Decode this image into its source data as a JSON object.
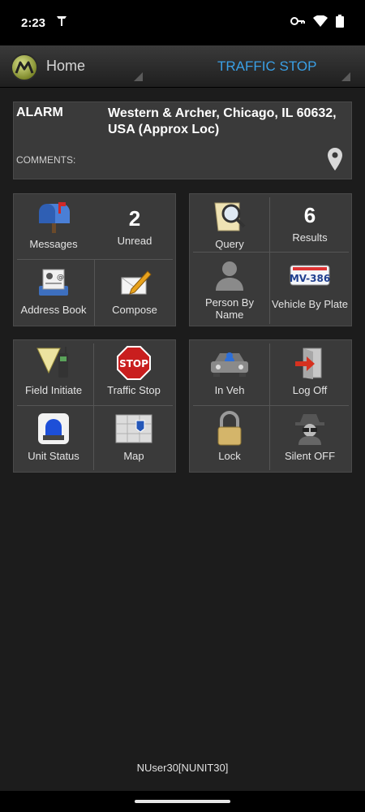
{
  "status_bar": {
    "time": "2:23"
  },
  "header": {
    "title": "Home",
    "mode": "TRAFFIC STOP"
  },
  "alarm": {
    "type": "ALARM",
    "address": "Western & Archer, Chicago, IL 60632, USA (Approx Loc)",
    "comments_label": "COMMENTS:"
  },
  "messages_panel": {
    "messages": "Messages",
    "unread_count": "2",
    "unread": "Unread",
    "address_book": "Address Book",
    "compose": "Compose"
  },
  "query_panel": {
    "query": "Query",
    "results_count": "6",
    "results": "Results",
    "person_by_name": "Person By Name",
    "vehicle_by_plate": "Vehicle By Plate",
    "plate_text": "MV-386"
  },
  "actions_panel": {
    "field_initiate": "Field Initiate",
    "traffic_stop": "Traffic Stop",
    "unit_status": "Unit Status",
    "map": "Map",
    "stop_sign_text": "STOP"
  },
  "vehicle_panel": {
    "in_veh": "In Veh",
    "log_off": "Log Off",
    "lock": "Lock",
    "silent_off": "Silent OFF"
  },
  "footer": {
    "user": "NUser30[NUNIT30]"
  },
  "colors": {
    "accent": "#3aa0e6",
    "panel": "#3a3a3a",
    "background": "#1c1c1c"
  }
}
